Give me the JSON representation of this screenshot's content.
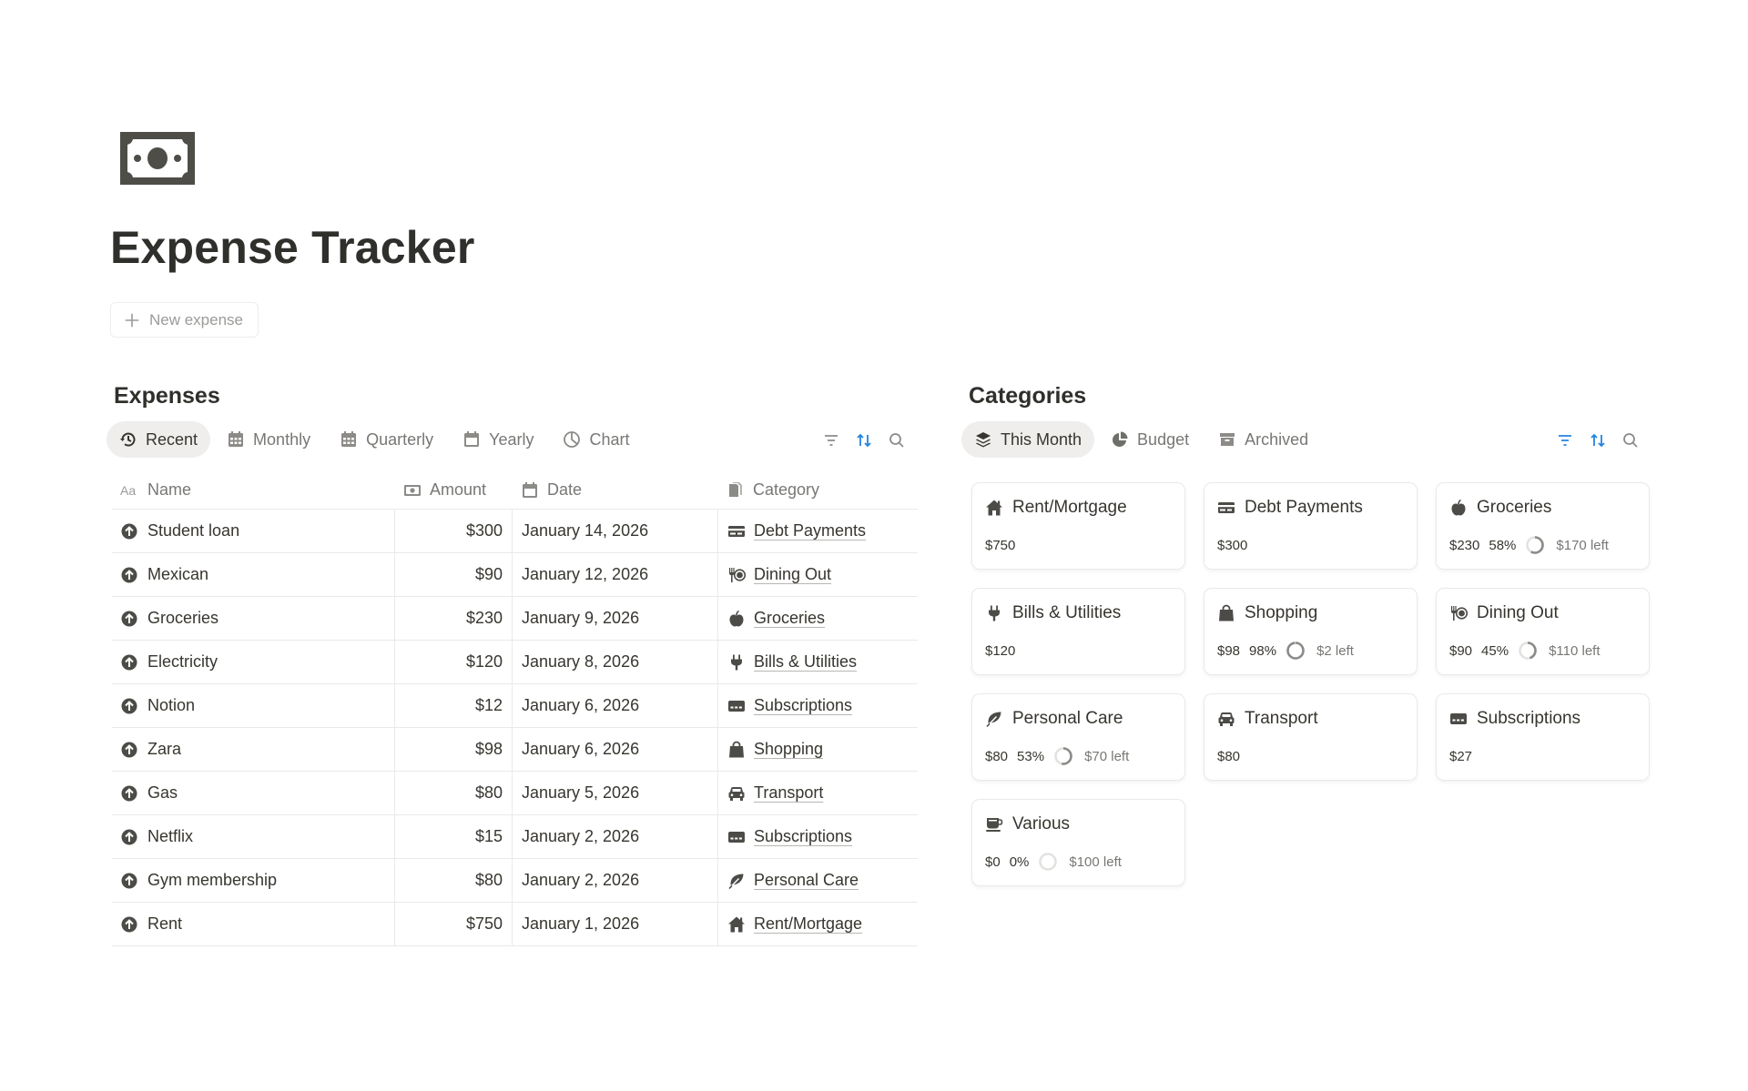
{
  "page": {
    "title": "Expense Tracker",
    "icon": "money-bill-icon",
    "new_button_label": "New expense"
  },
  "expenses": {
    "title": "Expenses",
    "tabs": [
      {
        "label": "Recent",
        "icon": "history-icon",
        "active": true
      },
      {
        "label": "Monthly",
        "icon": "calendar-grid-icon",
        "active": false
      },
      {
        "label": "Quarterly",
        "icon": "calendar-grid-icon",
        "active": false
      },
      {
        "label": "Yearly",
        "icon": "calendar-icon",
        "active": false
      },
      {
        "label": "Chart",
        "icon": "pie-chart-icon",
        "active": false
      }
    ],
    "columns": {
      "name": "Name",
      "amount": "Amount",
      "date": "Date",
      "category": "Category"
    },
    "rows": [
      {
        "name": "Student loan",
        "amount": "$300",
        "date": "January 14, 2026",
        "category": "Debt Payments",
        "category_icon": "credit-card-icon"
      },
      {
        "name": "Mexican",
        "amount": "$90",
        "date": "January 12, 2026",
        "category": "Dining Out",
        "category_icon": "utensils-icon"
      },
      {
        "name": "Groceries",
        "amount": "$230",
        "date": "January 9, 2026",
        "category": "Groceries",
        "category_icon": "apple-icon"
      },
      {
        "name": "Electricity",
        "amount": "$120",
        "date": "January 8, 2026",
        "category": "Bills & Utilities",
        "category_icon": "plug-icon"
      },
      {
        "name": "Notion",
        "amount": "$12",
        "date": "January 6, 2026",
        "category": "Subscriptions",
        "category_icon": "card-icon"
      },
      {
        "name": "Zara",
        "amount": "$98",
        "date": "January 6, 2026",
        "category": "Shopping",
        "category_icon": "shopping-bag-icon"
      },
      {
        "name": "Gas",
        "amount": "$80",
        "date": "January 5, 2026",
        "category": "Transport",
        "category_icon": "car-icon"
      },
      {
        "name": "Netflix",
        "amount": "$15",
        "date": "January 2, 2026",
        "category": "Subscriptions",
        "category_icon": "card-icon"
      },
      {
        "name": "Gym membership",
        "amount": "$80",
        "date": "January 2, 2026",
        "category": "Personal Care",
        "category_icon": "leaf-icon"
      },
      {
        "name": "Rent",
        "amount": "$750",
        "date": "January 1, 2026",
        "category": "Rent/Mortgage",
        "category_icon": "house-icon"
      }
    ]
  },
  "categories": {
    "title": "Categories",
    "tabs": [
      {
        "label": "This Month",
        "icon": "layers-icon",
        "active": true
      },
      {
        "label": "Budget",
        "icon": "pie-chart-icon",
        "active": false
      },
      {
        "label": "Archived",
        "icon": "archive-icon",
        "active": false
      }
    ],
    "cards": [
      {
        "name": "Rent/Mortgage",
        "icon": "house-icon",
        "spent": "$750"
      },
      {
        "name": "Debt Payments",
        "icon": "credit-card-icon",
        "spent": "$300"
      },
      {
        "name": "Groceries",
        "icon": "apple-icon",
        "spent": "$230",
        "percent": "58%",
        "progress": 0.58,
        "left": "$170 left"
      },
      {
        "name": "Bills & Utilities",
        "icon": "plug-icon",
        "spent": "$120"
      },
      {
        "name": "Shopping",
        "icon": "shopping-bag-icon",
        "spent": "$98",
        "percent": "98%",
        "progress": 0.98,
        "left": "$2 left"
      },
      {
        "name": "Dining Out",
        "icon": "utensils-icon",
        "spent": "$90",
        "percent": "45%",
        "progress": 0.45,
        "left": "$110 left"
      },
      {
        "name": "Personal Care",
        "icon": "leaf-icon",
        "spent": "$80",
        "percent": "53%",
        "progress": 0.53,
        "left": "$70 left"
      },
      {
        "name": "Transport",
        "icon": "car-icon",
        "spent": "$80"
      },
      {
        "name": "Subscriptions",
        "icon": "card-icon",
        "spent": "$27"
      },
      {
        "name": "Various",
        "icon": "coffee-icon",
        "spent": "$0",
        "percent": "0%",
        "progress": 0,
        "left": "$100 left"
      }
    ]
  },
  "colors": {
    "accent_blue": "#2383e2",
    "icon_dark": "#4c4b47",
    "muted_text": "#787774"
  }
}
